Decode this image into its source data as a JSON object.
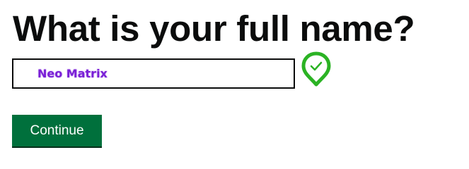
{
  "question": {
    "heading": "What is your full name?"
  },
  "name_field": {
    "value": "Neo Matrix",
    "value_color": "#7a1fd6",
    "validation_icon": "check-pin-icon",
    "validation_color": "#2bb324"
  },
  "actions": {
    "continue_label": "Continue",
    "continue_color": "#00703c"
  }
}
